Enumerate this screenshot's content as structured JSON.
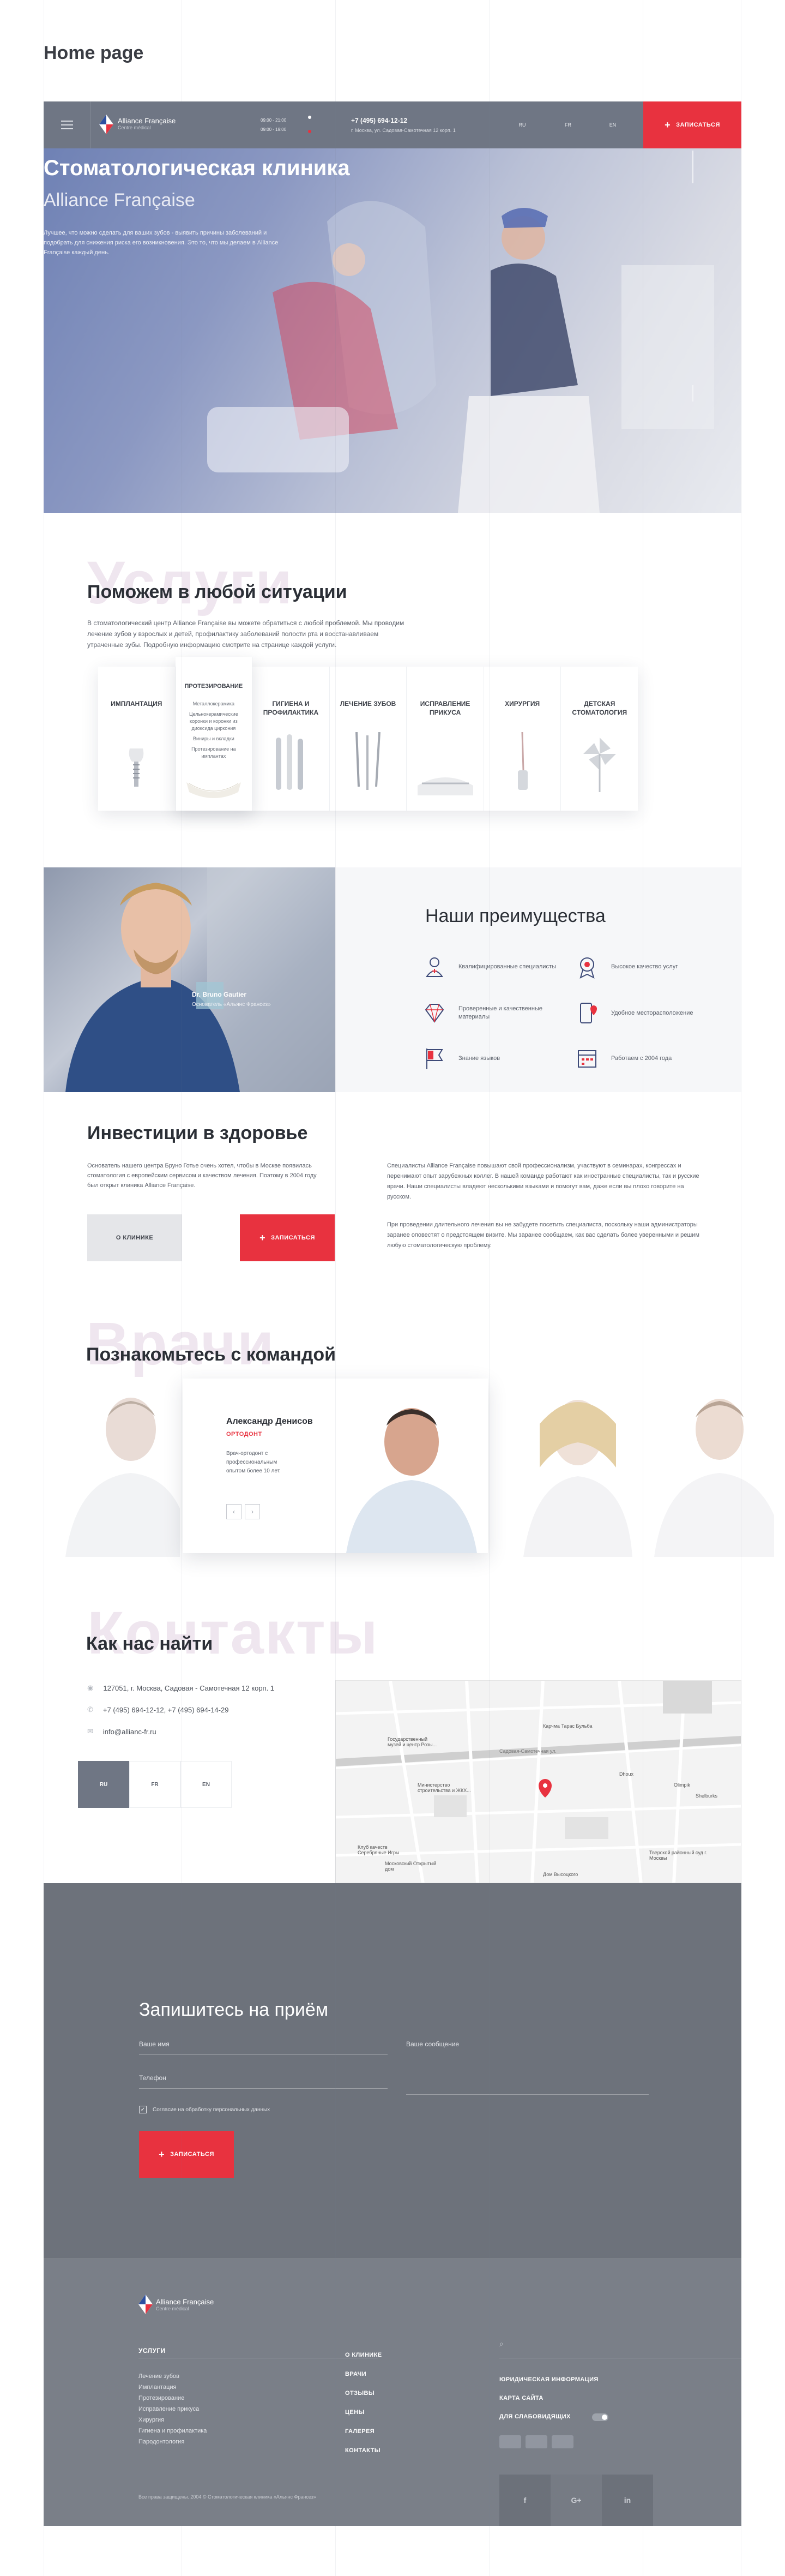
{
  "page_heading": "Home page",
  "header": {
    "logo_name": "Alliance Française",
    "logo_sub": "Centre médical",
    "hours_1": "09:00 - 21:00",
    "hours_2": "09:00 - 19:00",
    "phone": "+7 (495) 694-12-12",
    "address": "г. Москва, ул. Садовая-Самотечная 12 корп. 1",
    "langs": [
      "RU",
      "FR",
      "EN"
    ],
    "cta": "ЗАПИСАТЬСЯ"
  },
  "hero": {
    "title": "Стоматологическая клиника",
    "subtitle": "Alliance Française",
    "text": "Лучшее, что можно сделать для ваших зубов - выявить причины заболеваний и подобрать для снижения риска его возникновения. Это то, что мы делаем в Alliance Française каждый день."
  },
  "services": {
    "ghost": "Услуги",
    "title": "Поможем в любой ситуации",
    "text": "В стоматологический центр Alliance Française вы можете обратиться с любой проблемой. Мы проводим лечение зубов у взрослых и детей, профилактику заболеваний полости рта и восстанавливаем утраченные зубы. Подробную информацию смотрите на странице каждой услуги.",
    "cards": [
      {
        "label": "ИМПЛАНТАЦИЯ"
      },
      {
        "label": "ПРОТЕЗИРОВАНИЕ",
        "sub": [
          "Металлокерамика",
          "Цельнокерамические коронки и коронки из диоксида циркония",
          "Виниры и вкладки",
          "Протезирование на имплантах"
        ]
      },
      {
        "label": "ГИГИЕНА И ПРОФИЛАКТИКА"
      },
      {
        "label": "ЛЕЧЕНИЕ ЗУБОВ"
      },
      {
        "label": "ИСПРАВЛЕНИЕ ПРИКУСА"
      },
      {
        "label": "ХИРУРГИЯ"
      },
      {
        "label": "ДЕТСКАЯ СТОМАТОЛОГИЯ"
      }
    ]
  },
  "doctor_photo": {
    "name": "Dr. Bruno Gautier",
    "role": "Основатель «Альянс Франсез»"
  },
  "advantages": {
    "title": "Наши преимущества",
    "items": [
      {
        "icon": "doctor-icon",
        "text": "Квалифицированные специалисты"
      },
      {
        "icon": "medal-icon",
        "text": "Высокое качество услуг"
      },
      {
        "icon": "diamond-icon",
        "text": "Проверенные и качественные материалы"
      },
      {
        "icon": "location-phone-icon",
        "text": "Удобное месторасположение"
      },
      {
        "icon": "flag-icon",
        "text": "Знание языков"
      },
      {
        "icon": "calendar-icon",
        "text": "Работаем с 2004 года"
      }
    ]
  },
  "invest": {
    "title": "Инвестиции в здоровье",
    "text": "Основатель нашего центра Бруно Готье очень хотел, чтобы в Москве появилась стоматология с европейским сервисом и качеством лечения. Поэтому в 2004 году был открыт клиника Alliance Française.",
    "btn_about": "О КЛИНИКЕ",
    "btn_book": "ЗАПИСАТЬСЯ",
    "right_p1": "Специалисты Alliance Française повышают свой профессионализм, участвуют в семинарах, конгрессах и перенимают опыт зарубежных коллег. В нашей команде работают как иностранные специалисты, так и русские врачи. Наши специалисты владеют несколькими языками и помогут вам, даже если вы плохо говорите на русском.",
    "right_p2": "При проведении длительного лечения вы не забудете посетить специалиста, поскольку наши администраторы заранее оповестят о предстоящем визите. Мы заранее сообщаем, как вас сделать более уверенными и решим любую стоматологическую проблему."
  },
  "team": {
    "ghost": "Врачи",
    "title": "Познакомьтесь с командой",
    "card_name": "Александр Денисов",
    "card_role": "ОРТОДОНТ",
    "card_text": "Врач-ортодонт с профессиональным опытом более 10 лет.",
    "prev": "‹",
    "next": "›"
  },
  "contacts": {
    "ghost": "Контакты",
    "title": "Как нас найти",
    "address": "127051, г. Москва, Садовая - Самотечная 12 корп. 1",
    "phones": "+7 (495) 694-12-12, +7 (495) 694-14-29",
    "email": "info@allianc-fr.ru",
    "langs": [
      "RU",
      "FR",
      "EN"
    ],
    "map_labels": [
      "Государственный музей и центр Розы...",
      "Карчма Тарас Бульба",
      "Садовая-Самотечная ул.",
      "Dhoux",
      "Olimpik",
      "Shelburks",
      "Министерство строительства и ЖКХ...",
      "Клуб качеств Серебряные Игры",
      "Московский Открытый дом",
      "Тверской районный суд г. Москвы",
      "Дом Высоцкого"
    ]
  },
  "form": {
    "title": "Запишитесь на приём",
    "name_placeholder": "Ваше имя",
    "phone_placeholder": "Телефон",
    "message_placeholder": "Ваше сообщение",
    "consent": "Согласие на обработку персональных данных",
    "submit": "ЗАПИСАТЬСЯ"
  },
  "footer": {
    "logo_name": "Alliance Française",
    "logo_sub": "Centre médical",
    "services_head": "УСЛУГИ",
    "services": [
      "Лечение зубов",
      "Имплантация",
      "Протезирование",
      "Исправление прикуса",
      "Хирургия",
      "Гигиена и профилактика",
      "Пародонтология"
    ],
    "links": [
      "О КЛИНИКЕ",
      "ВРАЧИ",
      "ОТЗЫВЫ",
      "ЦЕНЫ",
      "ГАЛЕРЕЯ",
      "КОНТАКТЫ"
    ],
    "legal": "ЮРИДИЧЕСКАЯ ИНФОРМАЦИЯ",
    "sitemap": "КАРТА САЙТА",
    "accessibility": "ДЛЯ СЛАБОВИДЯЩИХ",
    "copyright": "Все права защищены. 2004 © Стоматологическая клиника «Альянс Франсез»",
    "social": [
      "f",
      "G+",
      "in"
    ]
  },
  "colors": {
    "accent": "#e8323f",
    "header": "#6f7684",
    "form_bg": "#6d727b",
    "footer_bg": "#7a7f88"
  }
}
